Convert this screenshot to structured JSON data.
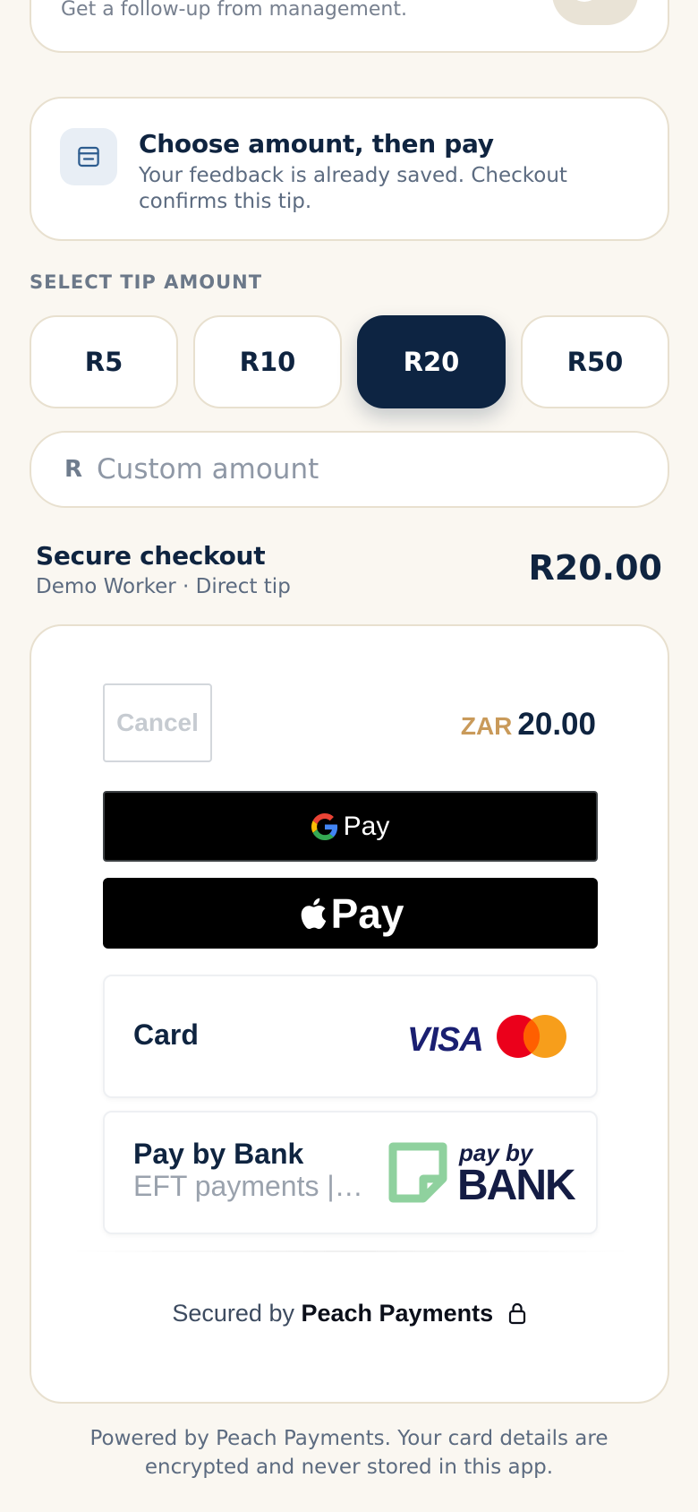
{
  "followup": {
    "text": "Get a follow-up from management."
  },
  "info": {
    "icon": "checkout-icon",
    "title": "Choose amount, then pay",
    "description": "Your feedback is already saved. Checkout confirms this tip."
  },
  "tips": {
    "heading": "SELECT TIP AMOUNT",
    "options": [
      "R5",
      "R10",
      "R20",
      "R50"
    ],
    "selected": "R20"
  },
  "custom_amount": {
    "prefix": "R",
    "placeholder": "Custom amount",
    "value": ""
  },
  "checkout": {
    "title": "Secure checkout",
    "subtitle": "Demo Worker · Direct tip",
    "total": "R20.00"
  },
  "payment": {
    "cancel_label": "Cancel",
    "currency": "ZAR",
    "amount": "20.00",
    "gpay_label": "Pay",
    "applepay_label": "Pay",
    "card_label": "Card",
    "visa_label": "VISA",
    "bank_label": "Pay by Bank",
    "bank_sub": "EFT payments | …",
    "paybybank_small": "pay by",
    "paybybank_big": "BANK",
    "secured_prefix": "Secured by",
    "secured_brand": "Peach Payments"
  },
  "footer": {
    "note": "Powered by Peach Payments. Your card details are encrypted and never stored in this app."
  },
  "colors": {
    "background": "#faf7f1",
    "navy": "#0d2442",
    "muted": "#5c6b80",
    "border": "#e8e0cf",
    "zar_gold": "#c99a5a"
  }
}
